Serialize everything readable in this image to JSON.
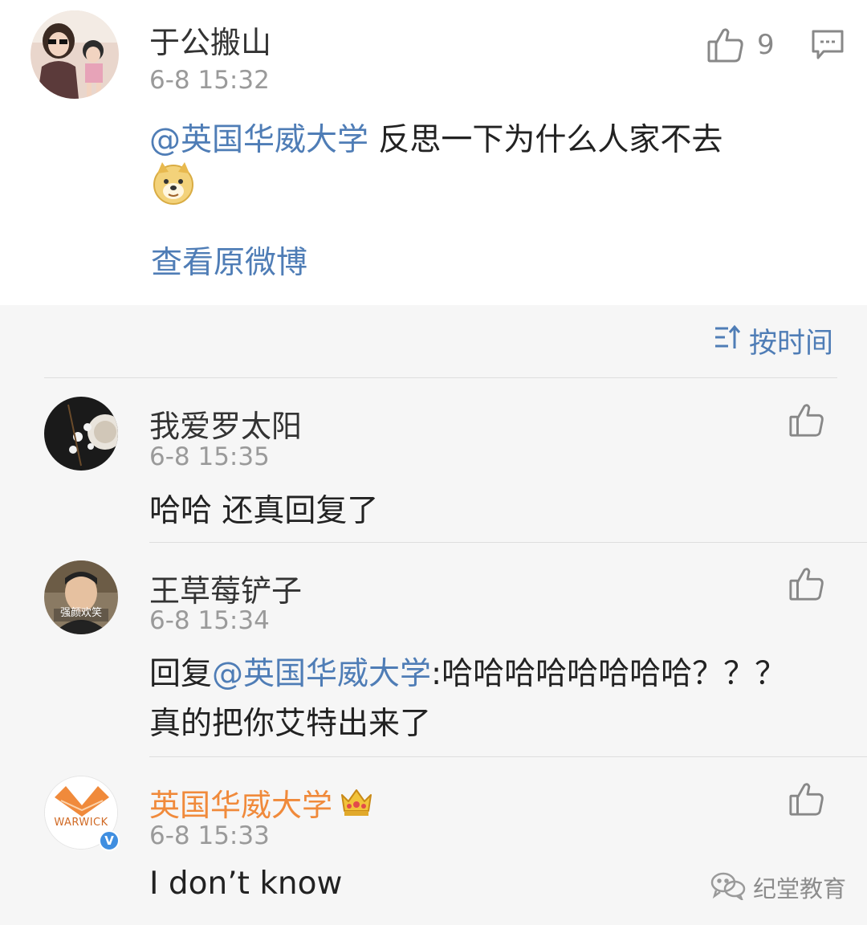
{
  "post": {
    "author": "于公搬山",
    "time": "6-8 15:32",
    "mention": "@英国华威大学",
    "text": " 反思一下为什么人家不去",
    "like_count": "9",
    "view_original": "查看原微博"
  },
  "sort": {
    "label": "按时间",
    "icon": "sort-time-icon"
  },
  "replies": [
    {
      "author": "我爱罗太阳",
      "time": "6-8 15:35",
      "text": "哈哈 还真回复了"
    },
    {
      "author": "王草莓铲子",
      "time": "6-8 15:34",
      "reply_prefix": "回复",
      "mention": "@英国华威大学",
      "line1_text": ":哈哈哈哈哈哈哈哈？？？",
      "line2_text": "真的把你艾特出来了",
      "avatar_caption": "强颜欢笑"
    },
    {
      "author": "英国华威大学",
      "time": "6-8 15:33",
      "text": "I don’t know",
      "avatar_text": "WARWICK",
      "badge": "V"
    }
  ],
  "watermark": {
    "text": "纪堂教育"
  },
  "colors": {
    "link": "#4f7db6",
    "orange": "#f08a3b",
    "background": "#f6f6f6"
  }
}
